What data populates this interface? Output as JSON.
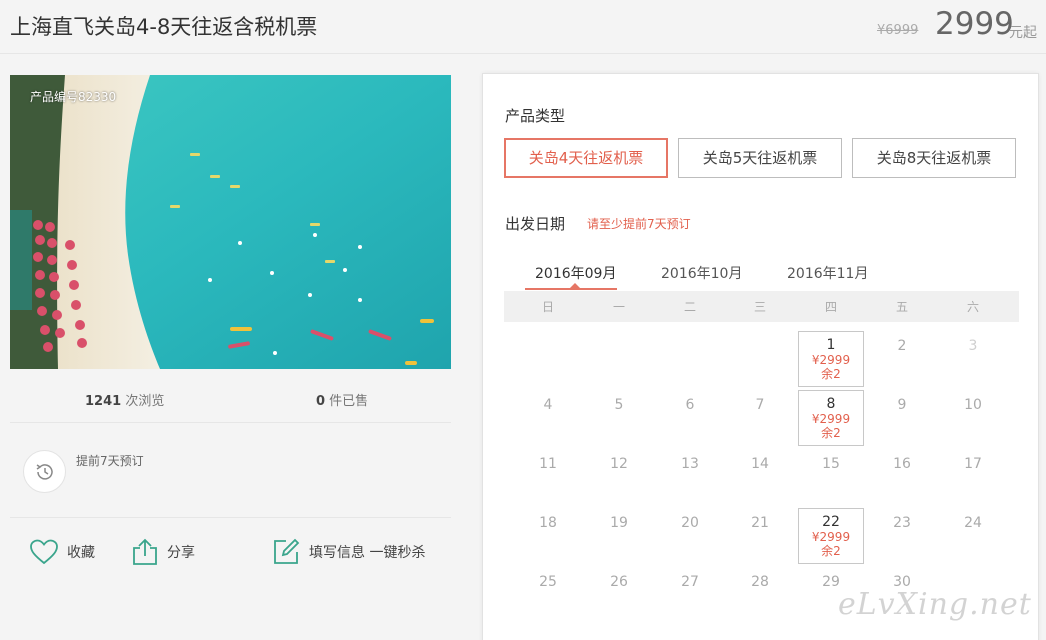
{
  "header": {
    "title": "上海直飞关岛4-8天往返含税机票",
    "old_price": "¥6999",
    "price": "2999",
    "price_unit": "元起"
  },
  "photo": {
    "product_no": "产品编号82330"
  },
  "stats": {
    "views_count": "1241",
    "views_label": " 次浏览",
    "sold_count": "0",
    "sold_label": " 件已售"
  },
  "advance": {
    "text": "提前7天预订"
  },
  "actions": {
    "favorite": "收藏",
    "share": "分享",
    "fill_info": "填写信息 一键秒杀"
  },
  "product_type": {
    "label": "产品类型",
    "options": [
      "关岛4天往返机票",
      "关岛5天往返机票",
      "关岛8天往返机票"
    ],
    "selected": "关岛4天往返机票"
  },
  "departure": {
    "label": "出发日期",
    "hint": "请至少提前7天预订",
    "months": [
      "2016年09月",
      "2016年10月",
      "2016年11月"
    ],
    "selected_month": "2016年09月",
    "weekdays": [
      "日",
      "一",
      "二",
      "三",
      "四",
      "五",
      "六"
    ],
    "days": [
      {
        "d": "1",
        "price": "¥2999",
        "left": "余2"
      },
      {
        "d": "2"
      },
      {
        "d": "3"
      },
      {
        "d": "4"
      },
      {
        "d": "5"
      },
      {
        "d": "6"
      },
      {
        "d": "7"
      },
      {
        "d": "8",
        "price": "¥2999",
        "left": "余2"
      },
      {
        "d": "9"
      },
      {
        "d": "10"
      },
      {
        "d": "11"
      },
      {
        "d": "12"
      },
      {
        "d": "13"
      },
      {
        "d": "14"
      },
      {
        "d": "15"
      },
      {
        "d": "16"
      },
      {
        "d": "17"
      },
      {
        "d": "18"
      },
      {
        "d": "19"
      },
      {
        "d": "20"
      },
      {
        "d": "21"
      },
      {
        "d": "22",
        "price": "¥2999",
        "left": "余2"
      },
      {
        "d": "23"
      },
      {
        "d": "24"
      },
      {
        "d": "25"
      },
      {
        "d": "26"
      },
      {
        "d": "27"
      },
      {
        "d": "28"
      },
      {
        "d": "29"
      },
      {
        "d": "30"
      }
    ]
  },
  "watermark": "eLvXing.net",
  "colors": {
    "accent": "#e2604d",
    "icon_green": "#3aa58c"
  }
}
